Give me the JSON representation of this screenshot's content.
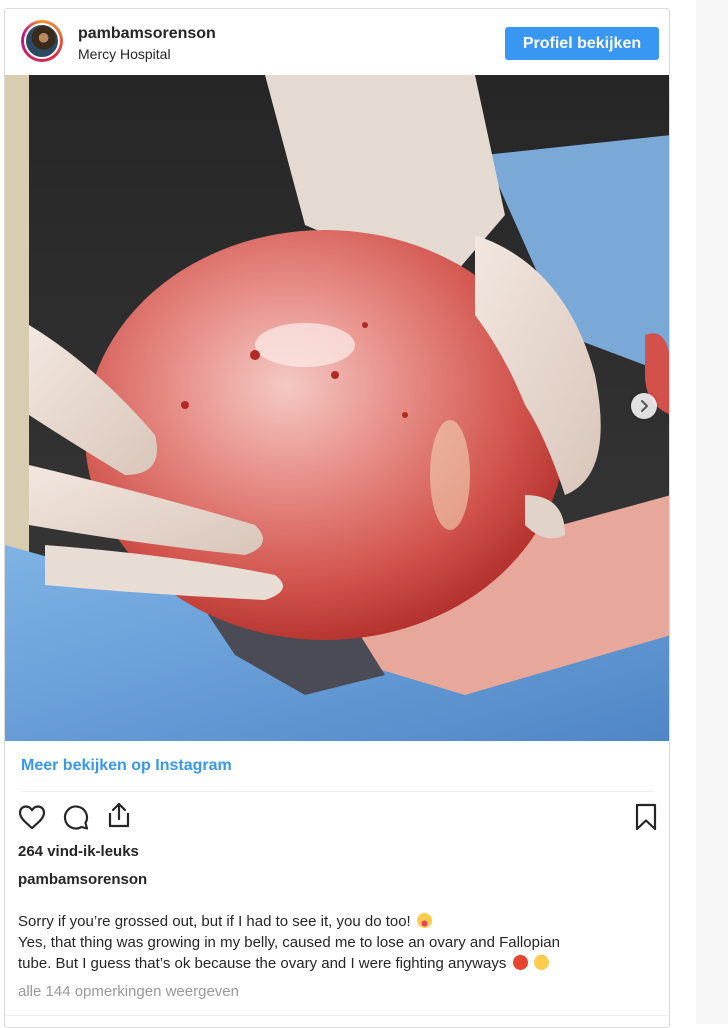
{
  "header": {
    "username": "pambamsorenson",
    "location": "Mercy Hospital",
    "profile_button": "Profiel bekijken"
  },
  "post": {
    "image_alt": "",
    "more_link": "Meer bekijken op Instagram",
    "likes": "264 vind-ik-leuks",
    "caption_user": "pambamsorenson",
    "caption_lines": [
      "Sorry if you’re grossed out, but if I had to see it, you do too!",
      "Yes, that thing was growing in my belly, caused me to lose an ovary and Fallopian",
      "tube. But I guess that’s ok because the ovary and I were fighting anyways"
    ],
    "comments_link": "alle 144 opmerkingen weergeven"
  },
  "icons": {
    "like": "heart-icon",
    "comment": "comment-icon",
    "share": "share-icon",
    "save": "bookmark-icon",
    "next": "chevron-right-icon"
  },
  "colors": {
    "accent": "#3897f0",
    "text": "#262626",
    "muted": "#999999"
  }
}
